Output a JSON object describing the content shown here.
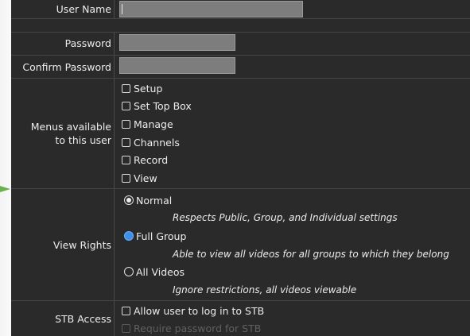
{
  "form": {
    "username": {
      "label": "User Name",
      "value": ""
    },
    "password": {
      "label": "Password",
      "value": ""
    },
    "confirm_password": {
      "label": "Confirm Password",
      "value": ""
    },
    "menus": {
      "label_line1": "Menus available",
      "label_line2": "to this user",
      "options": [
        {
          "label": "Setup",
          "checked": false
        },
        {
          "label": "Set Top Box",
          "checked": false
        },
        {
          "label": "Manage",
          "checked": false
        },
        {
          "label": "Channels",
          "checked": false
        },
        {
          "label": "Record",
          "checked": false
        },
        {
          "label": "View",
          "checked": false
        }
      ]
    },
    "view_rights": {
      "label": "View Rights",
      "options": [
        {
          "label": "Normal",
          "description": "Respects Public, Group, and Individual settings",
          "state": "selected"
        },
        {
          "label": "Full Group",
          "description": "Able to view all videos for all groups to which they belong",
          "state": "focused"
        },
        {
          "label": "All Videos",
          "description": "Ignore restrictions, all videos viewable",
          "state": "unselected"
        }
      ]
    },
    "stb_access": {
      "label": "STB Access",
      "options": [
        {
          "label": "Allow user to log in to STB",
          "checked": false,
          "enabled": true
        },
        {
          "label": "Require password for STB",
          "checked": false,
          "enabled": false
        }
      ]
    }
  },
  "colors": {
    "panel_bg": "#2a2a2a",
    "field_bg": "#7d7d7d",
    "radio_focus": "#3d8fe8",
    "arrow": "#6ab04c"
  },
  "icons": {
    "pointer": "green-arrow-icon"
  }
}
